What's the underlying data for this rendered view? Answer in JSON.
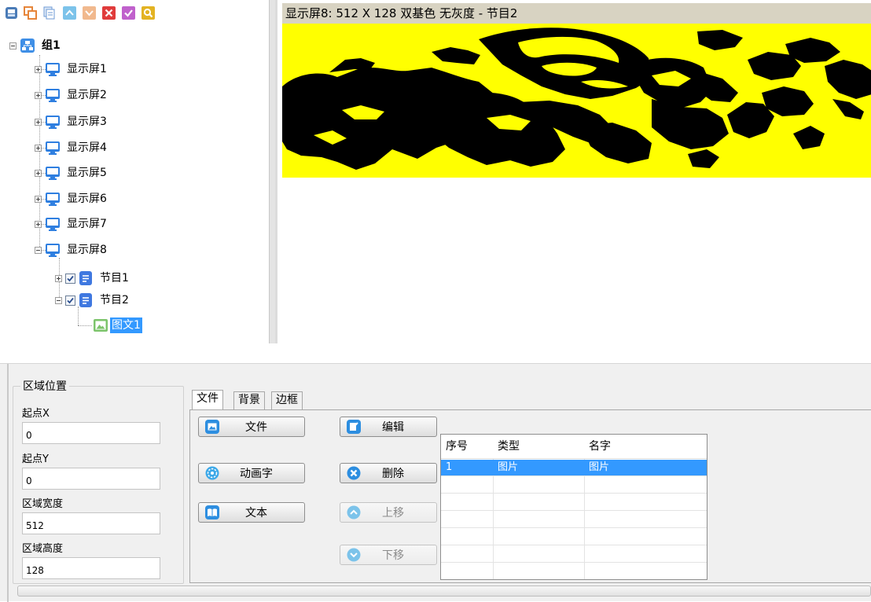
{
  "toolbar": {
    "icons": [
      "program-icon",
      "layers-icon",
      "copy-icon",
      "move-up-icon",
      "move-down-icon",
      "delete-icon",
      "check-icon",
      "search-icon"
    ],
    "colors": {
      "program": "#4a7bb7",
      "layers": "#e6853a",
      "copy": "#6e9ad6",
      "up": "#7cc3ea",
      "down": "#f1b98e",
      "delete": "#e03b3b",
      "check": "#c061cc",
      "search": "#e3b323"
    }
  },
  "tree": {
    "group_label": "组1",
    "screens": [
      "显示屏1",
      "显示屏2",
      "显示屏3",
      "显示屏4",
      "显示屏5",
      "显示屏6",
      "显示屏7",
      "显示屏8"
    ],
    "programs": [
      "节目1",
      "节目2"
    ],
    "area_label": "图文1"
  },
  "preview": {
    "title": "显示屏8: 512 X 128  双基色 无灰度 - 节目2",
    "canvas_color": "#ffff00"
  },
  "region": {
    "title": "区域位置",
    "fields": [
      {
        "label": "起点X",
        "value": "0"
      },
      {
        "label": "起点Y",
        "value": "0"
      },
      {
        "label": "区域宽度",
        "value": "512"
      },
      {
        "label": "区域高度",
        "value": "128"
      }
    ]
  },
  "tabs": [
    "文件",
    "背景",
    "边框"
  ],
  "buttons": {
    "file": "文件",
    "animated_text": "动画字",
    "text": "文本",
    "edit": "编辑",
    "delete": "删除",
    "move_up": "上移",
    "move_down": "下移"
  },
  "table": {
    "headers": [
      "序号",
      "类型",
      "名字"
    ],
    "rows": [
      {
        "index": "1",
        "type": "图片",
        "name": "图片"
      }
    ]
  }
}
